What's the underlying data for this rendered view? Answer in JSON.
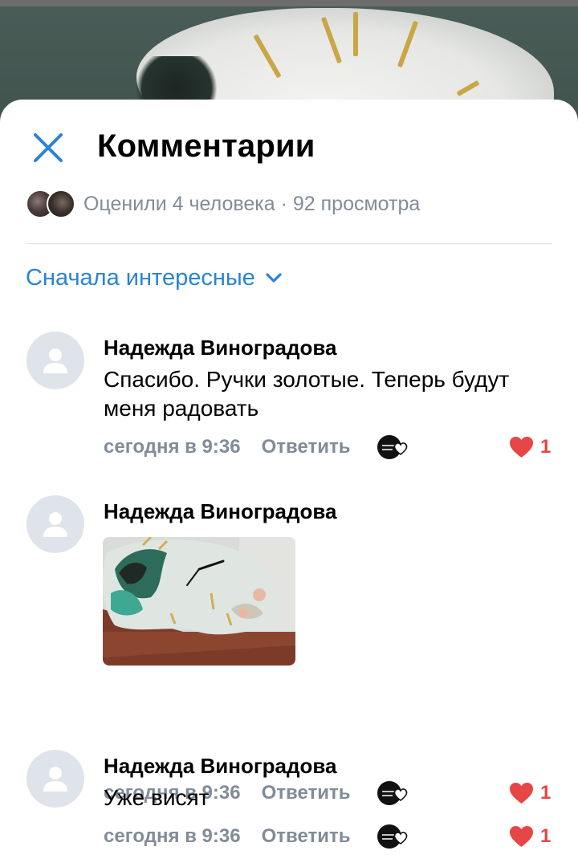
{
  "header": {
    "title": "Комментарии"
  },
  "likes_summary": {
    "text": "Оценили 4 человека · 92 просмотра"
  },
  "sort": {
    "label": "Сначала интересные"
  },
  "comments": [
    {
      "author": "Надежда Виноградова",
      "text": "Спасибо. Ручки золотые. Теперь будут меня радовать",
      "time": "сегодня в 9:36",
      "reply": "Ответить",
      "likes": "1"
    },
    {
      "author": "Надежда Виноградова",
      "text": "",
      "time": "сегодня в 9:36",
      "reply": "Ответить",
      "likes": "1",
      "has_image": true
    },
    {
      "author": "Надежда Виноградова",
      "text": "Уже висят",
      "time": "сегодня в 9:36",
      "reply": "Ответить",
      "likes": "1"
    }
  ],
  "colors": {
    "accent": "#2a83d4",
    "muted": "#818c99",
    "like": "#e64646"
  },
  "icons": [
    "close-icon",
    "chevron-down-icon",
    "user-placeholder-icon",
    "heart-icon",
    "author-liked-icon"
  ]
}
